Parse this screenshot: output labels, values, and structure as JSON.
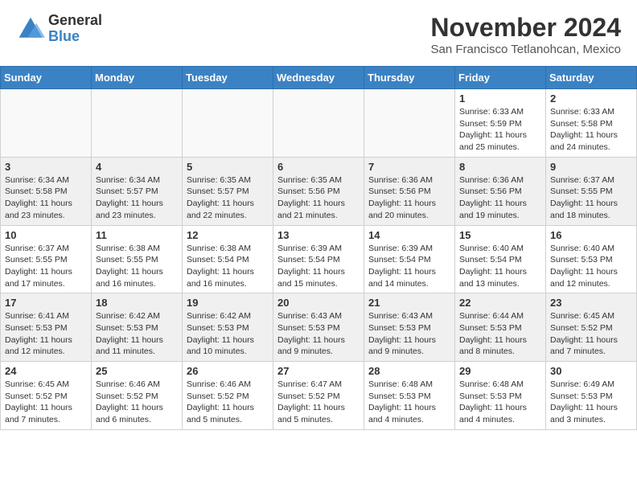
{
  "header": {
    "logo_general": "General",
    "logo_blue": "Blue",
    "month_title": "November 2024",
    "location": "San Francisco Tetlanohcan, Mexico"
  },
  "weekdays": [
    "Sunday",
    "Monday",
    "Tuesday",
    "Wednesday",
    "Thursday",
    "Friday",
    "Saturday"
  ],
  "weeks": [
    [
      {
        "day": "",
        "info": ""
      },
      {
        "day": "",
        "info": ""
      },
      {
        "day": "",
        "info": ""
      },
      {
        "day": "",
        "info": ""
      },
      {
        "day": "",
        "info": ""
      },
      {
        "day": "1",
        "info": "Sunrise: 6:33 AM\nSunset: 5:59 PM\nDaylight: 11 hours and 25 minutes."
      },
      {
        "day": "2",
        "info": "Sunrise: 6:33 AM\nSunset: 5:58 PM\nDaylight: 11 hours and 24 minutes."
      }
    ],
    [
      {
        "day": "3",
        "info": "Sunrise: 6:34 AM\nSunset: 5:58 PM\nDaylight: 11 hours and 23 minutes."
      },
      {
        "day": "4",
        "info": "Sunrise: 6:34 AM\nSunset: 5:57 PM\nDaylight: 11 hours and 23 minutes."
      },
      {
        "day": "5",
        "info": "Sunrise: 6:35 AM\nSunset: 5:57 PM\nDaylight: 11 hours and 22 minutes."
      },
      {
        "day": "6",
        "info": "Sunrise: 6:35 AM\nSunset: 5:56 PM\nDaylight: 11 hours and 21 minutes."
      },
      {
        "day": "7",
        "info": "Sunrise: 6:36 AM\nSunset: 5:56 PM\nDaylight: 11 hours and 20 minutes."
      },
      {
        "day": "8",
        "info": "Sunrise: 6:36 AM\nSunset: 5:56 PM\nDaylight: 11 hours and 19 minutes."
      },
      {
        "day": "9",
        "info": "Sunrise: 6:37 AM\nSunset: 5:55 PM\nDaylight: 11 hours and 18 minutes."
      }
    ],
    [
      {
        "day": "10",
        "info": "Sunrise: 6:37 AM\nSunset: 5:55 PM\nDaylight: 11 hours and 17 minutes."
      },
      {
        "day": "11",
        "info": "Sunrise: 6:38 AM\nSunset: 5:55 PM\nDaylight: 11 hours and 16 minutes."
      },
      {
        "day": "12",
        "info": "Sunrise: 6:38 AM\nSunset: 5:54 PM\nDaylight: 11 hours and 16 minutes."
      },
      {
        "day": "13",
        "info": "Sunrise: 6:39 AM\nSunset: 5:54 PM\nDaylight: 11 hours and 15 minutes."
      },
      {
        "day": "14",
        "info": "Sunrise: 6:39 AM\nSunset: 5:54 PM\nDaylight: 11 hours and 14 minutes."
      },
      {
        "day": "15",
        "info": "Sunrise: 6:40 AM\nSunset: 5:54 PM\nDaylight: 11 hours and 13 minutes."
      },
      {
        "day": "16",
        "info": "Sunrise: 6:40 AM\nSunset: 5:53 PM\nDaylight: 11 hours and 12 minutes."
      }
    ],
    [
      {
        "day": "17",
        "info": "Sunrise: 6:41 AM\nSunset: 5:53 PM\nDaylight: 11 hours and 12 minutes."
      },
      {
        "day": "18",
        "info": "Sunrise: 6:42 AM\nSunset: 5:53 PM\nDaylight: 11 hours and 11 minutes."
      },
      {
        "day": "19",
        "info": "Sunrise: 6:42 AM\nSunset: 5:53 PM\nDaylight: 11 hours and 10 minutes."
      },
      {
        "day": "20",
        "info": "Sunrise: 6:43 AM\nSunset: 5:53 PM\nDaylight: 11 hours and 9 minutes."
      },
      {
        "day": "21",
        "info": "Sunrise: 6:43 AM\nSunset: 5:53 PM\nDaylight: 11 hours and 9 minutes."
      },
      {
        "day": "22",
        "info": "Sunrise: 6:44 AM\nSunset: 5:53 PM\nDaylight: 11 hours and 8 minutes."
      },
      {
        "day": "23",
        "info": "Sunrise: 6:45 AM\nSunset: 5:52 PM\nDaylight: 11 hours and 7 minutes."
      }
    ],
    [
      {
        "day": "24",
        "info": "Sunrise: 6:45 AM\nSunset: 5:52 PM\nDaylight: 11 hours and 7 minutes."
      },
      {
        "day": "25",
        "info": "Sunrise: 6:46 AM\nSunset: 5:52 PM\nDaylight: 11 hours and 6 minutes."
      },
      {
        "day": "26",
        "info": "Sunrise: 6:46 AM\nSunset: 5:52 PM\nDaylight: 11 hours and 5 minutes."
      },
      {
        "day": "27",
        "info": "Sunrise: 6:47 AM\nSunset: 5:52 PM\nDaylight: 11 hours and 5 minutes."
      },
      {
        "day": "28",
        "info": "Sunrise: 6:48 AM\nSunset: 5:53 PM\nDaylight: 11 hours and 4 minutes."
      },
      {
        "day": "29",
        "info": "Sunrise: 6:48 AM\nSunset: 5:53 PM\nDaylight: 11 hours and 4 minutes."
      },
      {
        "day": "30",
        "info": "Sunrise: 6:49 AM\nSunset: 5:53 PM\nDaylight: 11 hours and 3 minutes."
      }
    ]
  ]
}
